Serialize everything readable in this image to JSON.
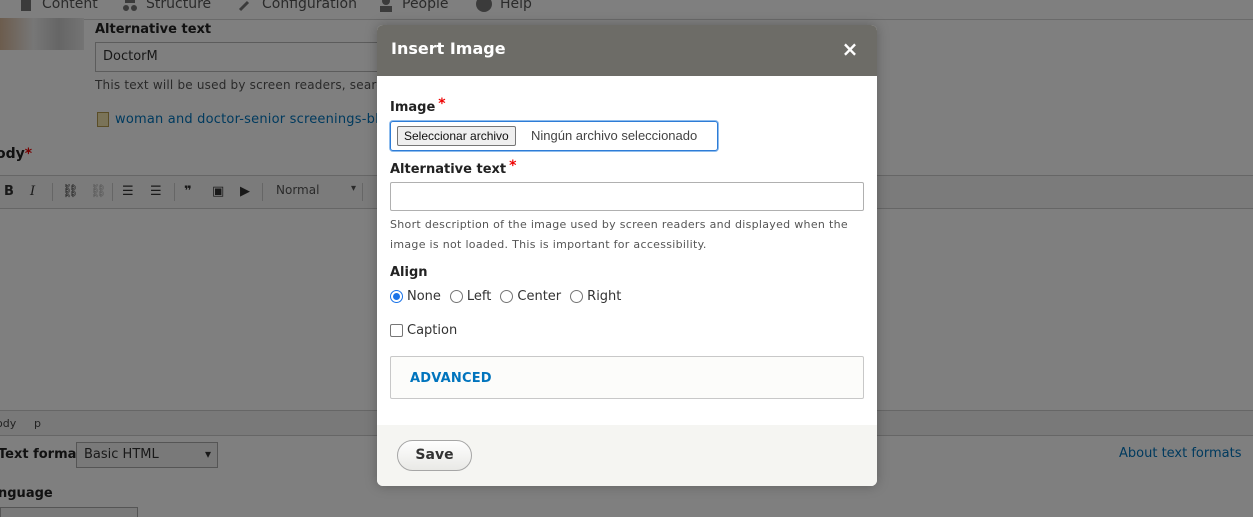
{
  "background": {
    "toolbar": {
      "items": [
        {
          "label": "Content",
          "icon": "document-icon"
        },
        {
          "label": "Structure",
          "icon": "structure-icon"
        },
        {
          "label": "Configuration",
          "icon": "wrench-icon"
        },
        {
          "label": "People",
          "icon": "people-icon"
        },
        {
          "label": "Help",
          "icon": "help-icon"
        }
      ]
    },
    "image_field": {
      "alt_label": "Alternative text",
      "alt_value": "DoctorM",
      "alt_help": "This text will be used by screen readers, search",
      "file_name": "woman and doctor-senior screenings-blo"
    },
    "body_label": "ody",
    "editor_toolbar": {
      "bold": "B",
      "italic": "I",
      "format_value": "Normal"
    },
    "path": [
      "ody",
      "p"
    ],
    "text_format": {
      "label": "Text format",
      "value": "Basic HTML",
      "about_link": "About text formats"
    },
    "language_label": "nguage"
  },
  "dialog": {
    "title": "Insert Image",
    "close_symbol": "×",
    "image_label": "Image",
    "required_mark": "*",
    "file_button": "Seleccionar archivo",
    "file_status": "Ningún archivo seleccionado",
    "alt_label": "Alternative text",
    "alt_value": "",
    "alt_help": "Short description of the image used by screen readers and displayed when the image is not loaded. This is important for accessibility.",
    "align_label": "Align",
    "align_options": [
      {
        "label": "None",
        "checked": true
      },
      {
        "label": "Left",
        "checked": false
      },
      {
        "label": "Center",
        "checked": false
      },
      {
        "label": "Right",
        "checked": false
      }
    ],
    "caption_label": "Caption",
    "caption_checked": false,
    "advanced_label": "ADVANCED",
    "save_label": "Save"
  },
  "colors": {
    "dialog_header": "#6d6c67",
    "link": "#0074bd",
    "required": "#e00000",
    "focus": "#2e7cd6"
  }
}
